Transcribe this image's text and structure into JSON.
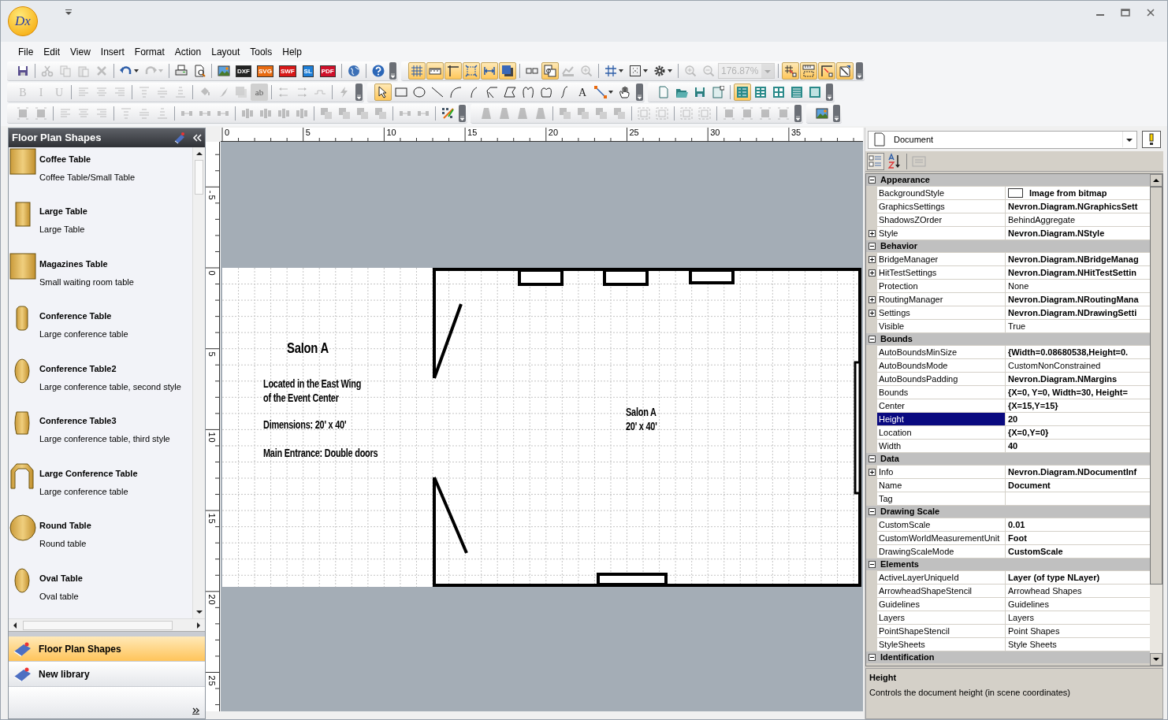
{
  "app": {
    "logo_text": "Dx"
  },
  "menu": [
    {
      "label": "File"
    },
    {
      "label": "Edit"
    },
    {
      "label": "View"
    },
    {
      "label": "Insert"
    },
    {
      "label": "Format"
    },
    {
      "label": "Action"
    },
    {
      "label": "Layout"
    },
    {
      "label": "Tools"
    },
    {
      "label": "Help"
    }
  ],
  "toolbar_rows": [
    [
      [
        [
          {
            "kind": "floppy",
            "on": false,
            "disabled": false
          }
        ],
        [
          {
            "kind": "scissors",
            "on": false,
            "disabled": true
          },
          {
            "kind": "copy",
            "on": false,
            "disabled": true
          },
          {
            "kind": "paste",
            "on": false,
            "disabled": true
          },
          {
            "kind": "cross",
            "on": false,
            "disabled": true
          }
        ],
        [
          {
            "kind": "undo",
            "on": false,
            "disabled": false
          },
          {
            "kind": "redo",
            "on": false,
            "disabled": true
          }
        ],
        [
          {
            "kind": "printer",
            "on": false,
            "disabled": false
          },
          {
            "kind": "preview",
            "on": false,
            "disabled": false
          }
        ],
        [
          {
            "kind": "landscape",
            "on": false,
            "disabled": false
          },
          {
            "kind": "file",
            "label": "DXF",
            "color": "#222222",
            "on": false,
            "disabled": false
          },
          {
            "kind": "file",
            "label": "SVG",
            "color": "#e86a10",
            "on": false,
            "disabled": false
          },
          {
            "kind": "file",
            "label": "SWF",
            "color": "#d81818",
            "on": false,
            "disabled": false
          },
          {
            "kind": "file",
            "label": "SL",
            "color": "#1e7fd8",
            "on": false,
            "disabled": false
          },
          {
            "kind": "file",
            "label": "PDF",
            "color": "#d0102a",
            "on": false,
            "disabled": false
          }
        ],
        [
          {
            "kind": "globe",
            "on": false,
            "disabled": false
          }
        ],
        [
          {
            "kind": "help",
            "on": false,
            "disabled": false
          }
        ]
      ],
      [
        [
          {
            "kind": "grid",
            "on": true,
            "disabled": false
          },
          {
            "kind": "ruler",
            "on": true,
            "disabled": false
          },
          {
            "kind": "guides",
            "on": true,
            "disabled": false
          },
          {
            "kind": "handles",
            "on": true,
            "disabled": false
          },
          {
            "kind": "double-arrow",
            "on": true,
            "disabled": false
          },
          {
            "kind": "shadow",
            "on": true,
            "disabled": false
          }
        ],
        [
          {
            "kind": "panes",
            "on": false,
            "disabled": false
          },
          {
            "kind": "format-copy",
            "on": true,
            "disabled": false
          },
          {
            "kind": "chart",
            "on": false,
            "disabled": true
          },
          {
            "kind": "zoom-in",
            "on": false,
            "disabled": true
          }
        ],
        [
          {
            "kind": "grid-menu",
            "on": false,
            "disabled": false
          },
          {
            "kind": "snap-menu",
            "on": false,
            "disabled": false
          },
          {
            "kind": "gear-menu",
            "on": false,
            "disabled": false
          }
        ],
        [
          {
            "kind": "zoom-in",
            "on": false,
            "disabled": true
          },
          {
            "kind": "zoom-out",
            "on": false,
            "disabled": true
          },
          {
            "kind": "zoom-combo",
            "label": "176.87%",
            "disabled": true
          }
        ],
        [
          {
            "kind": "grid-origin",
            "on": true,
            "disabled": false
          },
          {
            "kind": "ruler-origin",
            "on": true,
            "disabled": false
          },
          {
            "kind": "corner-origin",
            "on": true,
            "disabled": false
          },
          {
            "kind": "page-arrow",
            "on": true,
            "disabled": false
          }
        ]
      ]
    ],
    [
      [
        [
          {
            "kind": "letter",
            "label": "B",
            "on": false,
            "disabled": true
          },
          {
            "kind": "letter",
            "label": "I",
            "on": false,
            "disabled": true
          },
          {
            "kind": "letter",
            "label": "U",
            "on": false,
            "disabled": true
          }
        ],
        [
          {
            "kind": "align-left",
            "on": false,
            "disabled": true
          },
          {
            "kind": "align-center",
            "on": false,
            "disabled": true
          },
          {
            "kind": "align-right",
            "on": false,
            "disabled": true
          }
        ],
        [
          {
            "kind": "align-top",
            "on": false,
            "disabled": true
          },
          {
            "kind": "align-middle",
            "on": false,
            "disabled": true
          },
          {
            "kind": "align-bottom",
            "on": false,
            "disabled": true
          }
        ],
        [
          {
            "kind": "bucket",
            "on": false,
            "disabled": true
          },
          {
            "kind": "brush",
            "on": false,
            "disabled": true
          },
          {
            "kind": "shadow",
            "on": false,
            "disabled": true
          },
          {
            "kind": "letter-box",
            "label": "ab",
            "on": false,
            "disabled": true
          }
        ],
        [
          {
            "kind": "arrows-left",
            "on": false,
            "disabled": true
          },
          {
            "kind": "arrows-right",
            "on": false,
            "disabled": true
          },
          {
            "kind": "step-line",
            "on": false,
            "disabled": true
          }
        ],
        [
          {
            "kind": "lightning",
            "on": false,
            "disabled": true
          }
        ]
      ],
      [
        [
          {
            "kind": "pointer",
            "on": true,
            "disabled": false
          },
          {
            "kind": "rectangle",
            "on": false,
            "disabled": false
          },
          {
            "kind": "ellipse",
            "on": false,
            "disabled": false
          },
          {
            "kind": "line",
            "on": false,
            "disabled": false
          },
          {
            "kind": "arc",
            "on": false,
            "disabled": false
          },
          {
            "kind": "arc-small",
            "on": false,
            "disabled": false
          },
          {
            "kind": "polyline",
            "on": false,
            "disabled": false
          },
          {
            "kind": "polygon",
            "on": false,
            "disabled": false
          },
          {
            "kind": "curve",
            "on": false,
            "disabled": false
          },
          {
            "kind": "closed-curve",
            "on": false,
            "disabled": false
          },
          {
            "kind": "bezier",
            "on": false,
            "disabled": false
          },
          {
            "kind": "letter",
            "label": "A",
            "on": false,
            "disabled": false
          },
          {
            "kind": "connector",
            "on": false,
            "disabled": false
          },
          {
            "kind": "lasso",
            "on": false,
            "disabled": false
          }
        ]
      ],
      [
        [
          {
            "kind": "new-page",
            "on": false,
            "disabled": false
          },
          {
            "kind": "folder",
            "on": false,
            "disabled": false
          },
          {
            "kind": "floppy-teal",
            "on": false,
            "disabled": false
          },
          {
            "kind": "new-window",
            "on": false,
            "disabled": false
          }
        ],
        [
          {
            "kind": "tiles-list",
            "on": true,
            "disabled": false
          },
          {
            "kind": "tiles-small",
            "on": false,
            "disabled": false
          },
          {
            "kind": "tiles-large",
            "on": false,
            "disabled": false
          },
          {
            "kind": "tiles-lines",
            "on": false,
            "disabled": false
          },
          {
            "kind": "tile-single",
            "on": false,
            "disabled": false
          }
        ]
      ]
    ],
    [
      [
        [
          {
            "kind": "fit",
            "on": false,
            "disabled": true
          },
          {
            "kind": "fit",
            "on": false,
            "disabled": true
          }
        ],
        [
          {
            "kind": "align-left",
            "on": false,
            "disabled": true
          },
          {
            "kind": "align-center",
            "on": false,
            "disabled": true
          },
          {
            "kind": "align-right",
            "on": false,
            "disabled": true
          }
        ],
        [
          {
            "kind": "align-top",
            "on": false,
            "disabled": true
          },
          {
            "kind": "align-middle",
            "on": false,
            "disabled": true
          },
          {
            "kind": "align-bottom",
            "on": false,
            "disabled": true
          }
        ],
        [
          {
            "kind": "spacing",
            "on": false,
            "disabled": true
          },
          {
            "kind": "spacing",
            "on": false,
            "disabled": true
          },
          {
            "kind": "spacing",
            "on": false,
            "disabled": true
          }
        ],
        [
          {
            "kind": "distribute",
            "on": false,
            "disabled": true
          },
          {
            "kind": "distribute",
            "on": false,
            "disabled": true
          },
          {
            "kind": "distribute",
            "on": false,
            "disabled": true
          },
          {
            "kind": "distribute",
            "on": false,
            "disabled": true
          }
        ],
        [
          {
            "kind": "stack",
            "on": false,
            "disabled": true
          },
          {
            "kind": "stack",
            "on": false,
            "disabled": true
          },
          {
            "kind": "stack",
            "on": false,
            "disabled": true
          },
          {
            "kind": "stack",
            "on": false,
            "disabled": true
          }
        ],
        [
          {
            "kind": "spacing",
            "on": false,
            "disabled": true
          },
          {
            "kind": "spacing",
            "on": false,
            "disabled": true
          }
        ],
        [
          {
            "kind": "scatter",
            "on": false,
            "disabled": false
          }
        ]
      ],
      [
        [
          {
            "kind": "trapezoid",
            "on": false,
            "disabled": true
          },
          {
            "kind": "trapezoid",
            "on": false,
            "disabled": true
          },
          {
            "kind": "trapezoid",
            "on": false,
            "disabled": true
          },
          {
            "kind": "trapezoid",
            "on": false,
            "disabled": true
          }
        ],
        [
          {
            "kind": "stack",
            "on": false,
            "disabled": true
          },
          {
            "kind": "stack",
            "on": false,
            "disabled": true
          },
          {
            "kind": "stack",
            "on": false,
            "disabled": true
          },
          {
            "kind": "stack",
            "on": false,
            "disabled": true
          }
        ],
        [
          {
            "kind": "group",
            "on": false,
            "disabled": true
          },
          {
            "kind": "group",
            "on": false,
            "disabled": true
          }
        ],
        [
          {
            "kind": "group",
            "on": false,
            "disabled": true
          },
          {
            "kind": "group",
            "on": false,
            "disabled": true
          }
        ],
        [
          {
            "kind": "fit",
            "on": false,
            "disabled": true
          },
          {
            "kind": "fit",
            "on": false,
            "disabled": true
          },
          {
            "kind": "fit",
            "on": false,
            "disabled": true
          },
          {
            "kind": "fit",
            "on": false,
            "disabled": true
          }
        ]
      ],
      [
        [
          {
            "kind": "landscape",
            "on": false,
            "disabled": false
          }
        ]
      ]
    ]
  ],
  "library": {
    "title": "Floor Plan Shapes",
    "items": [
      {
        "title": "Coffee Table",
        "description": "Coffee Table/Small Table",
        "kind": "square"
      },
      {
        "title": "Large Table",
        "description": "Large Table",
        "kind": "tall"
      },
      {
        "title": "Magazines Table",
        "description": "Small waiting room table",
        "kind": "square"
      },
      {
        "title": "Conference Table",
        "description": "Large conference table",
        "kind": "pill"
      },
      {
        "title": "Conference Table2",
        "description": "Large conference table, second style",
        "kind": "oval"
      },
      {
        "title": "Conference Table3",
        "description": "Large conference table, third style",
        "kind": "barrel"
      },
      {
        "title": "Large Conference Table",
        "description": "Large conference table",
        "kind": "arch"
      },
      {
        "title": "Round Table",
        "description": "Round table",
        "kind": "circle"
      },
      {
        "title": "Oval Table",
        "description": "Oval table",
        "kind": "oval"
      }
    ],
    "libraries": [
      {
        "label": "Floor Plan Shapes",
        "selected": true
      },
      {
        "label": "New library",
        "selected": false
      }
    ]
  },
  "rulers": {
    "horizontal": [
      "0",
      "5",
      "10",
      "15",
      "20",
      "25",
      "30",
      "35"
    ],
    "vertical": [
      "-5",
      "0",
      "5",
      "10",
      "15",
      "20",
      "25"
    ]
  },
  "drawing": {
    "notes": [
      {
        "text": "Salon A",
        "kind": "heading"
      },
      {
        "text": "Located in the East Wing\nof the Event Center",
        "kind": "body"
      },
      {
        "text": "Dimensions: 20' x 40'",
        "kind": "body"
      },
      {
        "text": "Main Entrance: Double doors",
        "kind": "body"
      },
      {
        "text": "Salon A\n20' x 40'",
        "kind": "room"
      }
    ]
  },
  "properties": {
    "object": "Document",
    "categories": [
      {
        "name": "Appearance",
        "expanded": true,
        "rows": [
          {
            "name": "BackgroundStyle",
            "value": "Image from bitmap",
            "bold": true,
            "expandable": false,
            "selected": false,
            "swatch": true
          },
          {
            "name": "GraphicsSettings",
            "value": "Nevron.Diagram.NGraphicsSett",
            "bold": true,
            "expandable": false,
            "selected": false
          },
          {
            "name": "ShadowsZOrder",
            "value": "BehindAggregate",
            "bold": false,
            "expandable": false,
            "selected": false
          },
          {
            "name": "Style",
            "value": "Nevron.Diagram.NStyle",
            "bold": true,
            "expandable": true,
            "selected": false
          }
        ]
      },
      {
        "name": "Behavior",
        "expanded": true,
        "rows": [
          {
            "name": "BridgeManager",
            "value": "Nevron.Diagram.NBridgeManag",
            "bold": true,
            "expandable": true,
            "selected": false
          },
          {
            "name": "HitTestSettings",
            "value": "Nevron.Diagram.NHitTestSettin",
            "bold": true,
            "expandable": true,
            "selected": false
          },
          {
            "name": "Protection",
            "value": "None",
            "bold": false,
            "expandable": false,
            "selected": false
          },
          {
            "name": "RoutingManager",
            "value": "Nevron.Diagram.NRoutingMana",
            "bold": true,
            "expandable": true,
            "selected": false
          },
          {
            "name": "Settings",
            "value": "Nevron.Diagram.NDrawingSetti",
            "bold": true,
            "expandable": true,
            "selected": false
          },
          {
            "name": "Visible",
            "value": "True",
            "bold": false,
            "expandable": false,
            "selected": false
          }
        ]
      },
      {
        "name": "Bounds",
        "expanded": true,
        "rows": [
          {
            "name": "AutoBoundsMinSize",
            "value": "{Width=0.08680538,Height=0.",
            "bold": true,
            "expandable": false,
            "selected": false
          },
          {
            "name": "AutoBoundsMode",
            "value": "CustomNonConstrained",
            "bold": false,
            "expandable": false,
            "selected": false
          },
          {
            "name": "AutoBoundsPadding",
            "value": "Nevron.Diagram.NMargins",
            "bold": true,
            "expandable": false,
            "selected": false
          },
          {
            "name": "Bounds",
            "value": "{X=0, Y=0, Width=30, Height=",
            "bold": true,
            "expandable": false,
            "selected": false
          },
          {
            "name": "Center",
            "value": "{X=15,Y=15}",
            "bold": true,
            "expandable": false,
            "selected": false
          },
          {
            "name": "Height",
            "value": "20",
            "bold": true,
            "expandable": false,
            "selected": true
          },
          {
            "name": "Location",
            "value": "{X=0,Y=0}",
            "bold": true,
            "expandable": false,
            "selected": false
          },
          {
            "name": "Width",
            "value": "40",
            "bold": true,
            "expandable": false,
            "selected": false
          }
        ]
      },
      {
        "name": "Data",
        "expanded": true,
        "rows": [
          {
            "name": "Info",
            "value": "Nevron.Diagram.NDocumentInf",
            "bold": true,
            "expandable": true,
            "selected": false
          },
          {
            "name": "Name",
            "value": "Document",
            "bold": true,
            "expandable": false,
            "selected": false
          },
          {
            "name": "Tag",
            "value": "",
            "expandable": false,
            "selected": false
          }
        ]
      },
      {
        "name": "Drawing Scale",
        "expanded": true,
        "rows": [
          {
            "name": "CustomScale",
            "value": "0.01",
            "bold": true,
            "expandable": false,
            "selected": false
          },
          {
            "name": "CustomWorldMeasurementUnit",
            "value": "Foot",
            "bold": true,
            "expandable": false,
            "selected": false
          },
          {
            "name": "DrawingScaleMode",
            "value": "CustomScale",
            "bold": true,
            "expandable": false,
            "selected": false
          }
        ]
      },
      {
        "name": "Elements",
        "expanded": true,
        "rows": [
          {
            "name": "ActiveLayerUniqueId",
            "value": "Layer (of type NLayer)",
            "bold": true,
            "expandable": false,
            "selected": false
          },
          {
            "name": "ArrowheadShapeStencil",
            "value": "Arrowhead Shapes",
            "bold": false,
            "expandable": false,
            "selected": false
          },
          {
            "name": "Guidelines",
            "value": "Guidelines",
            "bold": false,
            "expandable": false,
            "selected": false
          },
          {
            "name": "Layers",
            "value": "Layers",
            "bold": false,
            "expandable": false,
            "selected": false
          },
          {
            "name": "PointShapeStencil",
            "value": "Point Shapes",
            "bold": false,
            "expandable": false,
            "selected": false
          },
          {
            "name": "StyleSheets",
            "value": "Style Sheets",
            "bold": false,
            "expandable": false,
            "selected": false
          }
        ]
      },
      {
        "name": "Identification",
        "expanded": true
      }
    ],
    "description": {
      "title": "Height",
      "text": "Controls the document height (in scene coordinates)"
    }
  }
}
